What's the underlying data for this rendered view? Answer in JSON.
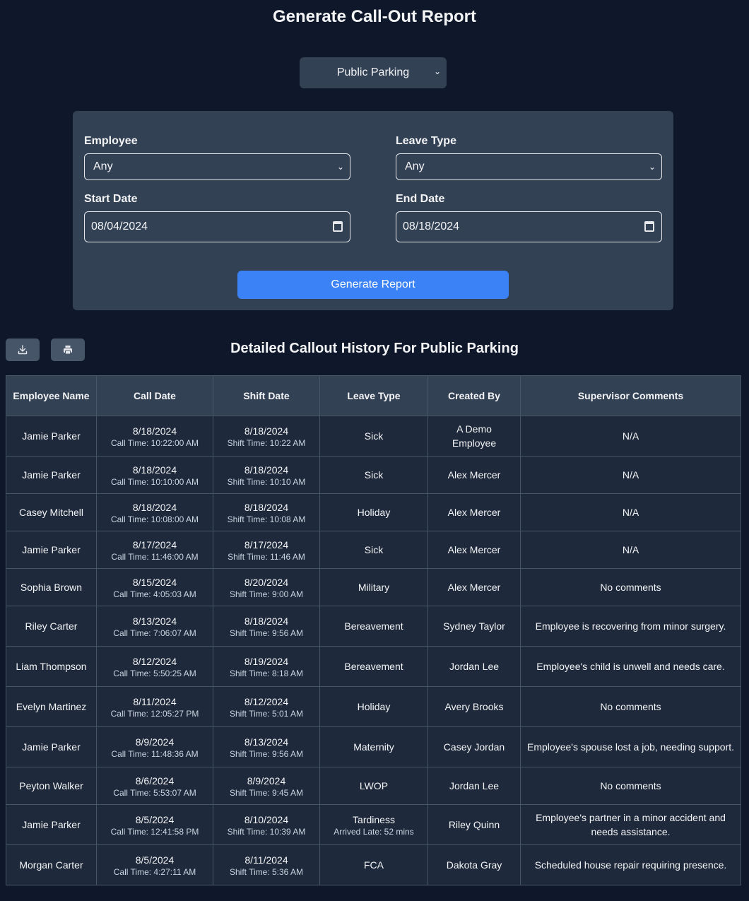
{
  "page_title": "Generate Call-Out Report",
  "location_select": {
    "value": "Public Parking"
  },
  "filters": {
    "employee": {
      "label": "Employee",
      "value": "Any"
    },
    "leave_type": {
      "label": "Leave Type",
      "value": "Any"
    },
    "start_date": {
      "label": "Start Date",
      "value": "08/04/2024"
    },
    "end_date": {
      "label": "End Date",
      "value": "08/18/2024"
    },
    "generate_label": "Generate Report"
  },
  "toolbar": {
    "download_icon": "download-icon",
    "print_icon": "print-icon"
  },
  "report_title": "Detailed Callout History For Public Parking",
  "table": {
    "headers": [
      "Employee Name",
      "Call Date",
      "Shift Date",
      "Leave Type",
      "Created By",
      "Supervisor Comments"
    ],
    "rows": [
      {
        "name": "Jamie Parker",
        "call_date": "8/18/2024",
        "call_time": "Call Time: 10:22:00 AM",
        "shift_date": "8/18/2024",
        "shift_time": "Shift Time: 10:22 AM",
        "leave_type": "Sick",
        "leave_note": "",
        "created_by": "A Demo Employee",
        "comments": "N/A"
      },
      {
        "name": "Jamie Parker",
        "call_date": "8/18/2024",
        "call_time": "Call Time: 10:10:00 AM",
        "shift_date": "8/18/2024",
        "shift_time": "Shift Time: 10:10 AM",
        "leave_type": "Sick",
        "leave_note": "",
        "created_by": "Alex Mercer",
        "comments": "N/A"
      },
      {
        "name": "Casey Mitchell",
        "call_date": "8/18/2024",
        "call_time": "Call Time: 10:08:00 AM",
        "shift_date": "8/18/2024",
        "shift_time": "Shift Time: 10:08 AM",
        "leave_type": "Holiday",
        "leave_note": "",
        "created_by": "Alex Mercer",
        "comments": "N/A"
      },
      {
        "name": "Jamie Parker",
        "call_date": "8/17/2024",
        "call_time": "Call Time: 11:46:00 AM",
        "shift_date": "8/17/2024",
        "shift_time": "Shift Time: 11:46 AM",
        "leave_type": "Sick",
        "leave_note": "",
        "created_by": "Alex Mercer",
        "comments": "N/A"
      },
      {
        "name": "Sophia Brown",
        "call_date": "8/15/2024",
        "call_time": "Call Time: 4:05:03 AM",
        "shift_date": "8/20/2024",
        "shift_time": "Shift Time: 9:00 AM",
        "leave_type": "Military",
        "leave_note": "",
        "created_by": "Alex Mercer",
        "comments": "No comments"
      },
      {
        "name": "Riley Carter",
        "call_date": "8/13/2024",
        "call_time": "Call Time: 7:06:07 AM",
        "shift_date": "8/18/2024",
        "shift_time": "Shift Time: 9:56 AM",
        "leave_type": "Bereavement",
        "leave_note": "",
        "created_by": "Sydney Taylor",
        "comments": "Employee is recovering from minor surgery."
      },
      {
        "name": "Liam Thompson",
        "call_date": "8/12/2024",
        "call_time": "Call Time: 5:50:25 AM",
        "shift_date": "8/19/2024",
        "shift_time": "Shift Time: 8:18 AM",
        "leave_type": "Bereavement",
        "leave_note": "",
        "created_by": "Jordan Lee",
        "comments": "Employee's child is unwell and needs care."
      },
      {
        "name": "Evelyn Martinez",
        "call_date": "8/11/2024",
        "call_time": "Call Time: 12:05:27 PM",
        "shift_date": "8/12/2024",
        "shift_time": "Shift Time: 5:01 AM",
        "leave_type": "Holiday",
        "leave_note": "",
        "created_by": "Avery Brooks",
        "comments": "No comments"
      },
      {
        "name": "Jamie Parker",
        "call_date": "8/9/2024",
        "call_time": "Call Time: 11:48:36 AM",
        "shift_date": "8/13/2024",
        "shift_time": "Shift Time: 9:56 AM",
        "leave_type": "Maternity",
        "leave_note": "",
        "created_by": "Casey Jordan",
        "comments": "Employee's spouse lost a job, needing support."
      },
      {
        "name": "Peyton Walker",
        "call_date": "8/6/2024",
        "call_time": "Call Time: 5:53:07 AM",
        "shift_date": "8/9/2024",
        "shift_time": "Shift Time: 9:45 AM",
        "leave_type": "LWOP",
        "leave_note": "",
        "created_by": "Jordan Lee",
        "comments": "No comments"
      },
      {
        "name": "Jamie Parker",
        "call_date": "8/5/2024",
        "call_time": "Call Time: 12:41:58 PM",
        "shift_date": "8/10/2024",
        "shift_time": "Shift Time: 10:39 AM",
        "leave_type": "Tardiness",
        "leave_note": "Arrived Late: 52 mins",
        "created_by": "Riley Quinn",
        "comments": "Employee's partner in a minor accident and needs assistance."
      },
      {
        "name": "Morgan Carter",
        "call_date": "8/5/2024",
        "call_time": "Call Time: 4:27:11 AM",
        "shift_date": "8/11/2024",
        "shift_time": "Shift Time: 5:36 AM",
        "leave_type": "FCA",
        "leave_note": "",
        "created_by": "Dakota Gray",
        "comments": "Scheduled house repair requiring presence."
      }
    ]
  }
}
